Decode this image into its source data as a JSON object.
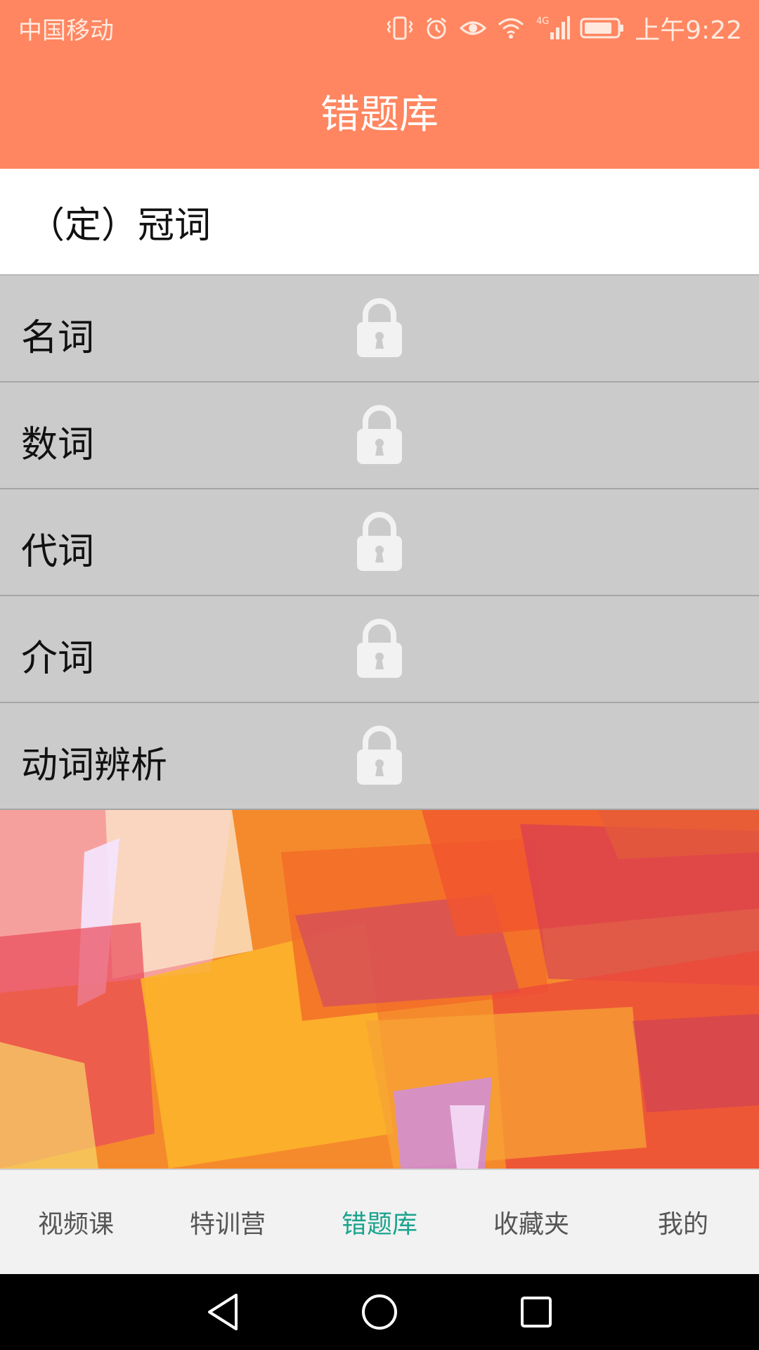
{
  "status_bar": {
    "carrier": "中国移动",
    "network": "4G",
    "time": "上午9:22",
    "icons": [
      "vibrate-icon",
      "alarm-icon",
      "eye-icon",
      "wifi-icon",
      "signal-icon",
      "battery-icon"
    ]
  },
  "header": {
    "title": "错题库"
  },
  "section": {
    "title": "（定）冠词"
  },
  "list": {
    "items": [
      {
        "label": "名词",
        "locked": true
      },
      {
        "label": "数词",
        "locked": true
      },
      {
        "label": "代词",
        "locked": true
      },
      {
        "label": "介词",
        "locked": true
      },
      {
        "label": "动词辨析",
        "locked": true
      }
    ]
  },
  "bottom_tabs": [
    {
      "label": "视频课",
      "active": false
    },
    {
      "label": "特训营",
      "active": false
    },
    {
      "label": "错题库",
      "active": true
    },
    {
      "label": "收藏夹",
      "active": false
    },
    {
      "label": "我的",
      "active": false
    }
  ],
  "colors": {
    "header": "#ff8660",
    "active_tab": "#1aa48e",
    "row_bg": "#cbcbcb"
  }
}
